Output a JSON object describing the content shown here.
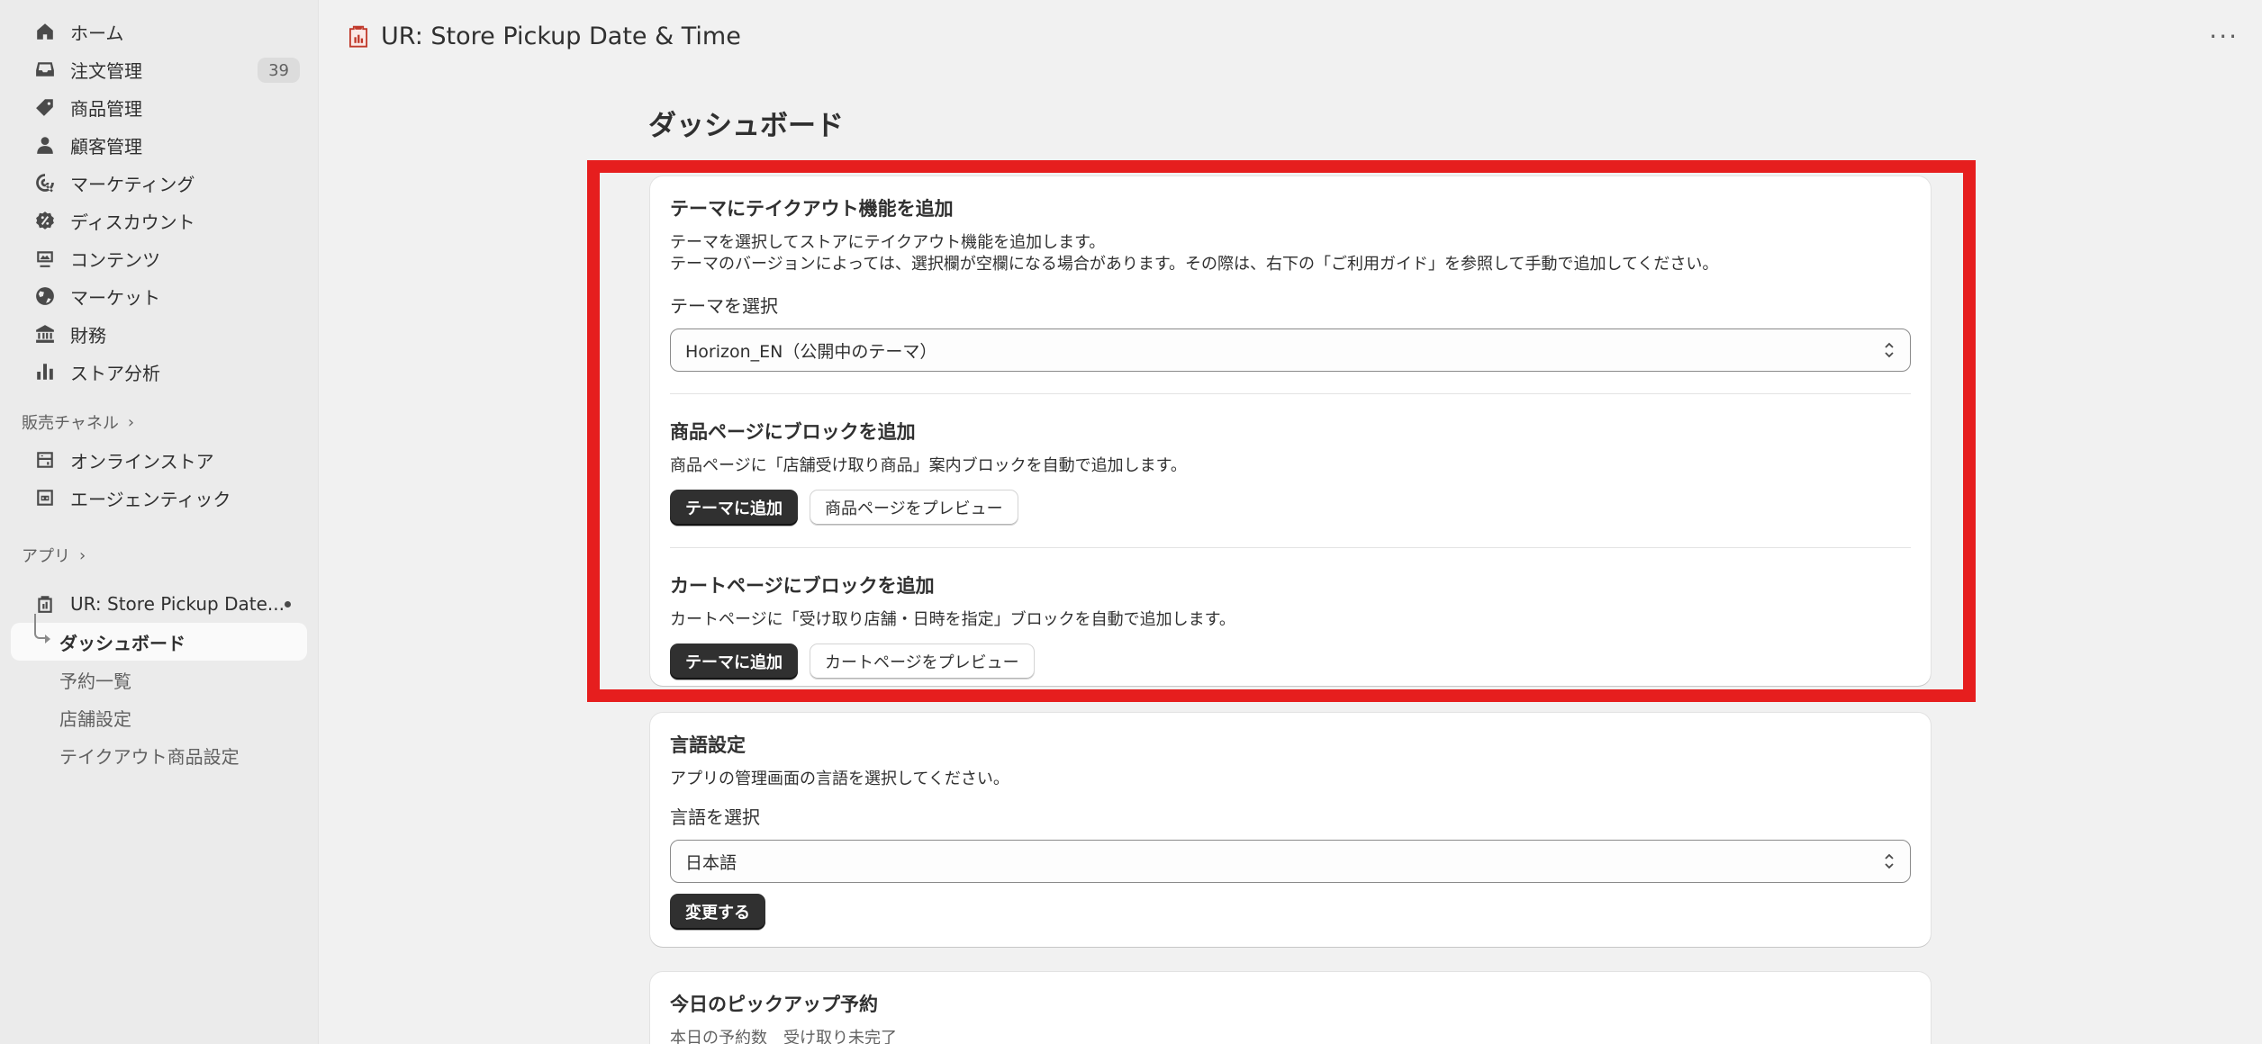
{
  "sidebar": {
    "items": [
      {
        "label": "ホーム",
        "icon": "home-icon"
      },
      {
        "label": "注文管理",
        "icon": "inbox-icon",
        "badge": "39"
      },
      {
        "label": "商品管理",
        "icon": "tag-icon"
      },
      {
        "label": "顧客管理",
        "icon": "person-icon"
      },
      {
        "label": "マーケティング",
        "icon": "target-icon"
      },
      {
        "label": "ディスカウント",
        "icon": "discount-icon"
      },
      {
        "label": "コンテンツ",
        "icon": "content-icon"
      },
      {
        "label": "マーケット",
        "icon": "globe-icon"
      },
      {
        "label": "財務",
        "icon": "bank-icon"
      },
      {
        "label": "ストア分析",
        "icon": "chart-icon"
      }
    ],
    "sales_channels": {
      "heading": "販売チャネル",
      "items": [
        {
          "label": "オンラインストア",
          "icon": "store-icon"
        },
        {
          "label": "エージェンティック",
          "icon": "agent-icon"
        }
      ]
    },
    "apps": {
      "heading": "アプリ",
      "app_name": "UR: Store Pickup Date...",
      "sub_items": [
        {
          "label": "ダッシュボード",
          "active": true
        },
        {
          "label": "予約一覧"
        },
        {
          "label": "店舗設定"
        },
        {
          "label": "テイクアウト商品設定"
        }
      ]
    }
  },
  "header": {
    "app_title": "UR: Store Pickup Date & Time",
    "more": "···"
  },
  "main": {
    "page_title": "ダッシュボード",
    "theme_card": {
      "title": "テーマにテイクアウト機能を追加",
      "desc_line1": "テーマを選択してストアにテイクアウト機能を追加します。",
      "desc_line2": "テーマのバージョンによっては、選択欄が空欄になる場合があります。その際は、右下の「ご利用ガイド」を参照して手動で追加してください。",
      "select_label": "テーマを選択",
      "select_value": "Horizon_EN（公開中のテーマ）",
      "product_block": {
        "title": "商品ページにブロックを追加",
        "desc": "商品ページに「店舗受け取り商品」案内ブロックを自動で追加します。",
        "add_button": "テーマに追加",
        "preview_button": "商品ページをプレビュー"
      },
      "cart_block": {
        "title": "カートページにブロックを追加",
        "desc": "カートページに「受け取り店舗・日時を指定」ブロックを自動で追加します。",
        "add_button": "テーマに追加",
        "preview_button": "カートページをプレビュー"
      }
    },
    "language_card": {
      "title": "言語設定",
      "desc": "アプリの管理画面の言語を選択してください。",
      "select_label": "言語を選択",
      "select_value": "日本語",
      "change_button": "変更する"
    },
    "pickup_card": {
      "title": "今日のピックアップ予約",
      "desc": "本日の予約数　受け取り未完了"
    }
  },
  "colors": {
    "highlight": "#e61e1e",
    "primary_button": "#303030",
    "sidebar_bg": "#ebebeb",
    "page_bg": "#f1f1f1"
  }
}
